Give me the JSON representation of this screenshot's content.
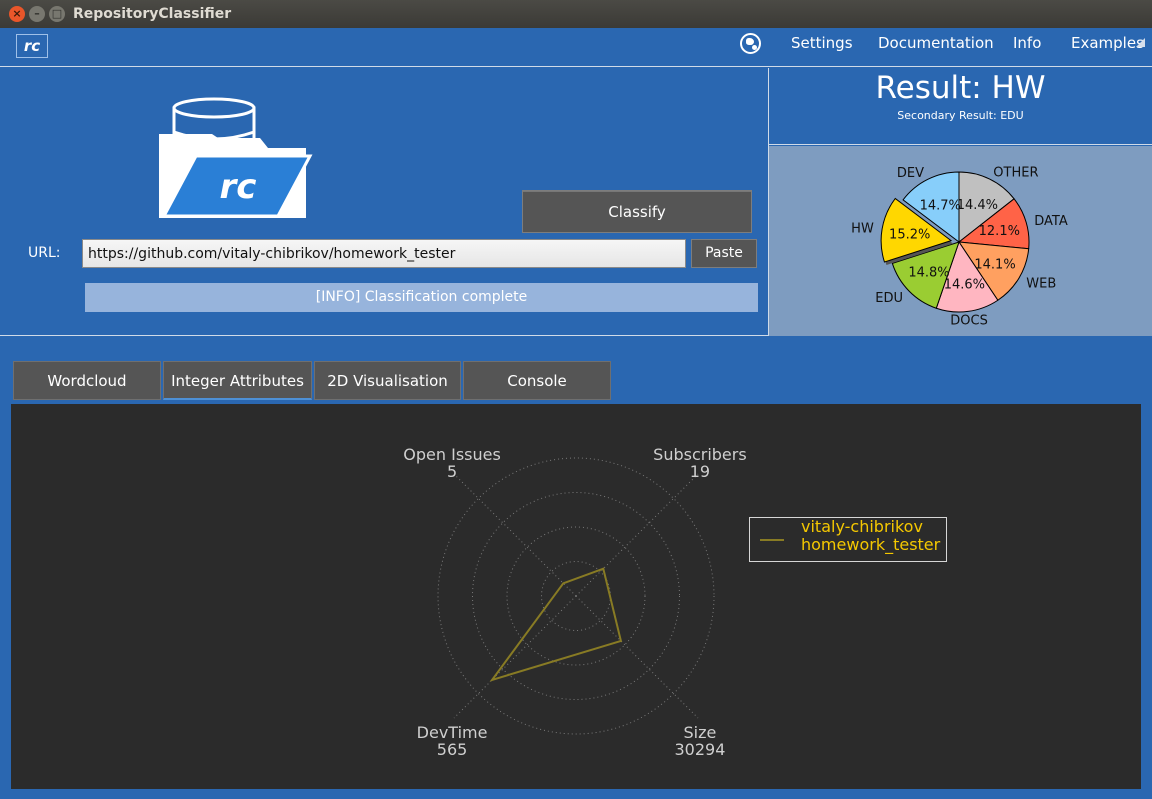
{
  "window": {
    "title": "RepositoryClassifier"
  },
  "menubar": {
    "logo_text": "rc",
    "items": [
      "Settings",
      "Documentation",
      "Info",
      "Examples"
    ]
  },
  "classifier": {
    "logo_text": "rc",
    "classify_label": "Classify",
    "url_label": "URL:",
    "url_value": "https://github.com/vitaly-chibrikov/homework_tester",
    "paste_label": "Paste",
    "status": "[INFO] Classification complete"
  },
  "result": {
    "title": "Result: HW",
    "secondary": "Secondary Result: EDU"
  },
  "pie_chart": {
    "slices": [
      {
        "name": "OTHER",
        "value": 14.4,
        "label": "14.4%",
        "color": "#c0c0c0"
      },
      {
        "name": "DATA",
        "value": 12.1,
        "label": "12.1%",
        "color": "#ff6347"
      },
      {
        "name": "WEB",
        "value": 14.1,
        "label": "14.1%",
        "color": "#ffa060"
      },
      {
        "name": "DOCS",
        "value": 14.6,
        "label": "14.6%",
        "color": "#ffb6c1"
      },
      {
        "name": "EDU",
        "value": 14.8,
        "label": "14.8%",
        "color": "#9acd32"
      },
      {
        "name": "HW",
        "value": 15.2,
        "label": "15.2%",
        "color": "#ffd700",
        "exploded": true
      },
      {
        "name": "DEV",
        "value": 14.7,
        "label": "14.7%",
        "color": "#87cefa"
      }
    ]
  },
  "tabs": [
    {
      "label": "Wordcloud",
      "active": false
    },
    {
      "label": "Integer Attributes",
      "active": true
    },
    {
      "label": "2D Visualisation",
      "active": false
    },
    {
      "label": "Console",
      "active": false
    }
  ],
  "chart_data": {
    "type": "radar",
    "axes": [
      {
        "name": "Subscribers",
        "value": "19"
      },
      {
        "name": "Size",
        "value": "30294"
      },
      {
        "name": "DevTime",
        "value": "565"
      },
      {
        "name": "Open Issues",
        "value": "5"
      }
    ],
    "series": [
      {
        "name": "vitaly-chibrikov homework_tester",
        "color": "#887b24",
        "values": [
          0.28,
          0.46,
          0.86,
          0.13
        ]
      }
    ],
    "legend_lines": [
      "vitaly-chibrikov",
      "homework_tester"
    ],
    "legend_position": "right",
    "grid": true
  }
}
